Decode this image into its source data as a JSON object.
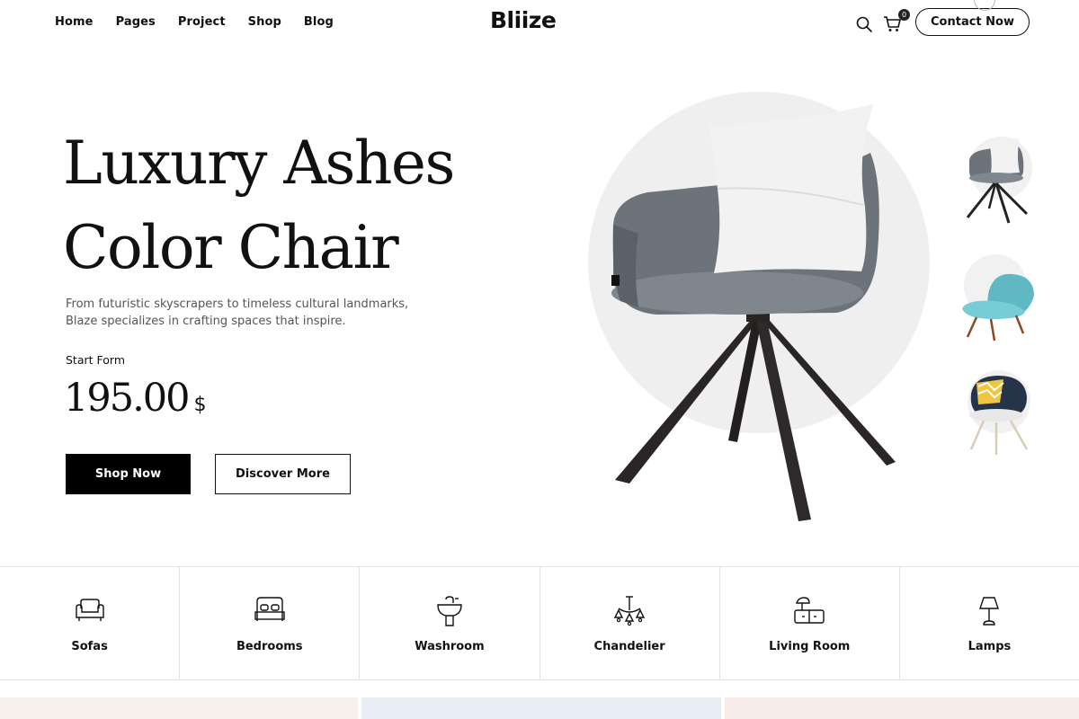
{
  "nav": {
    "items": [
      {
        "label": "Home"
      },
      {
        "label": "Pages"
      },
      {
        "label": "Project"
      },
      {
        "label": "Shop"
      },
      {
        "label": "Blog"
      }
    ]
  },
  "brand": {
    "name": "Bliize"
  },
  "header": {
    "cart_count": "0",
    "contact_label": "Contact Now",
    "icons": [
      "search-icon",
      "cart-icon"
    ]
  },
  "hero": {
    "title_line1": "Luxury Ashes",
    "title_line2": "Color Chair",
    "description": "From futuristic skyscrapers to timeless cultural landmarks, Blaze specializes in crafting spaces that inspire.",
    "start_label": "Start Form",
    "price": "195.00",
    "currency": "$",
    "shop_label": "Shop Now",
    "discover_label": "Discover More"
  },
  "categories": [
    {
      "label": "Sofas",
      "icon": "sofa-icon"
    },
    {
      "label": "Bedrooms",
      "icon": "bed-icon"
    },
    {
      "label": "Washroom",
      "icon": "sink-icon"
    },
    {
      "label": "Chandelier",
      "icon": "chandelier-icon"
    },
    {
      "label": "Living Room",
      "icon": "cabinet-lamp-icon"
    },
    {
      "label": "Lamps",
      "icon": "lamp-icon"
    }
  ],
  "colors": {
    "primary": "#000000",
    "text": "#111111",
    "muted": "#555555",
    "circle_bg": "#efefef",
    "strip_1": "#f5f1ea",
    "strip_2": "#e7eef5",
    "strip_3": "#f8ecea"
  }
}
